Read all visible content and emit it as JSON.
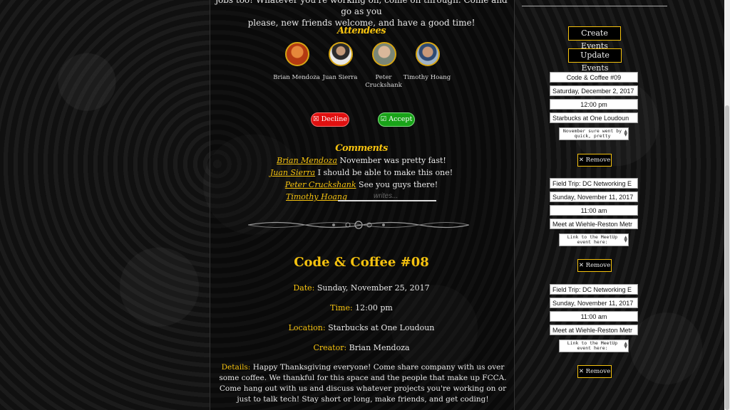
{
  "intro": {
    "line1": "jobs too! Whatever you're working on, come on through. Come and go as you",
    "line2": "please, new friends welcome, and have a good time!"
  },
  "attendees": {
    "heading": "Attendees",
    "people": [
      {
        "name": "Brian Mendoza",
        "color": "#c2461c"
      },
      {
        "name": "Juan Sierra",
        "color": "#3a3a3a"
      },
      {
        "name": "Peter Cruckshank",
        "color": "#7d8a7a"
      },
      {
        "name": "Timothy Hoang",
        "color": "#3e5f8a"
      }
    ]
  },
  "rsvp": {
    "decline_label": "☒ Decline",
    "accept_label": "☑ Accept"
  },
  "comments": {
    "heading": "Comments",
    "items": [
      {
        "author": "Brian Mendoza",
        "text": " November was pretty fast!"
      },
      {
        "author": "Juan Sierra",
        "text": " I should be able to make this one!"
      },
      {
        "author": "Peter Cruckshank",
        "text": " See you guys there!"
      }
    ],
    "current_user": "Timothy Hoang",
    "input_placeholder": "writes..."
  },
  "event": {
    "title": "Code & Coffee #08",
    "date_label": "Date:",
    "date": " Sunday, November 25, 2017",
    "time_label": "Time:",
    "time": " 12:00 pm",
    "location_label": "Location:",
    "location": " Starbucks at One Loudoun",
    "creator_label": "Creator:",
    "creator": " Brian Mendoza",
    "details_label": "Details:",
    "details": " Happy Thanksgiving everyone! Come share company with us over some coffee. We thankful for this space and the people that make up FCCA. Come hang out with us and discuss whatever projects you're working on or just to talk tech! Stay short or long, make friends, and get coding!"
  },
  "sidebar": {
    "create_label": "Create Events",
    "update_label": "Update Events",
    "remove_label": "✕ Remove",
    "cards": [
      {
        "title": "Code & Coffee #09",
        "date": "Saturday, December 2, 2017",
        "time": "12:00 pm",
        "location": "Starbucks at One Loudoun",
        "details": "November sure went by quick, pretty"
      },
      {
        "title": "Field Trip: DC Networking E",
        "date": "Sunday, November 11, 2017",
        "time": "11:00 am",
        "location": "Meet at Wiehle-Reston Metr",
        "details": "Link to the MeetUp event here:"
      },
      {
        "title": "Field Trip: DC Networking E",
        "date": "Sunday, November 11, 2017",
        "time": "11:00 am",
        "location": "Meet at Wiehle-Reston Metr",
        "details": "Link to the MeetUp event here:"
      }
    ]
  },
  "colors": {
    "accent": "#f5c20f",
    "decline": "#e01010",
    "accept": "#19a319"
  }
}
